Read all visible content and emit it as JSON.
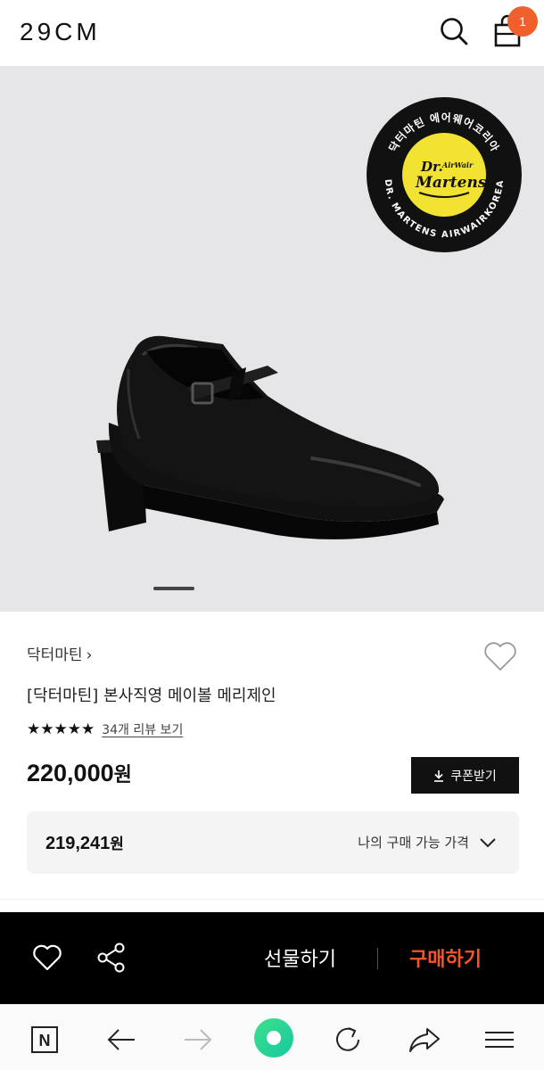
{
  "header": {
    "logo": "29CM",
    "cart_count": "1",
    "search_icon": "search-icon",
    "cart_icon": "shopping-bag-icon"
  },
  "hero": {
    "badge_text_top": "닥터마틴 에어웨어코리아",
    "badge_text_bottom": "DR. MARTENS AIRWAIRKOREA",
    "badge_logo_line1": "Dr.",
    "badge_logo_airwair": "AirWair",
    "badge_logo_line2": "Martens",
    "slide_index": 1
  },
  "product": {
    "brand": "닥터마틴",
    "title": "[닥터마틴] 본사직영 메이볼 메리제인",
    "rating_stars": "★★★★★",
    "rating_value": 5,
    "review_link": "34개 리뷰 보기",
    "price_number": "220,000",
    "price_unit": "원",
    "coupon_label": "쿠폰받기",
    "my_price_number": "219,241",
    "my_price_unit": "원",
    "my_price_label": "나의 구매 가능 가격"
  },
  "buy_bar": {
    "gift_label": "선물하기",
    "buy_label": "구매하기",
    "buy_color": "#f5542a"
  },
  "browser": {
    "n_label": "N",
    "items": [
      "home-icon",
      "back-arrow-icon",
      "forward-arrow-icon",
      "green-dot-icon",
      "refresh-icon",
      "share-arrow-icon",
      "menu-icon"
    ]
  },
  "colors": {
    "accent": "#f0602a",
    "hero_bg": "#e6e6e8",
    "badge_yellow": "#f2e231"
  }
}
